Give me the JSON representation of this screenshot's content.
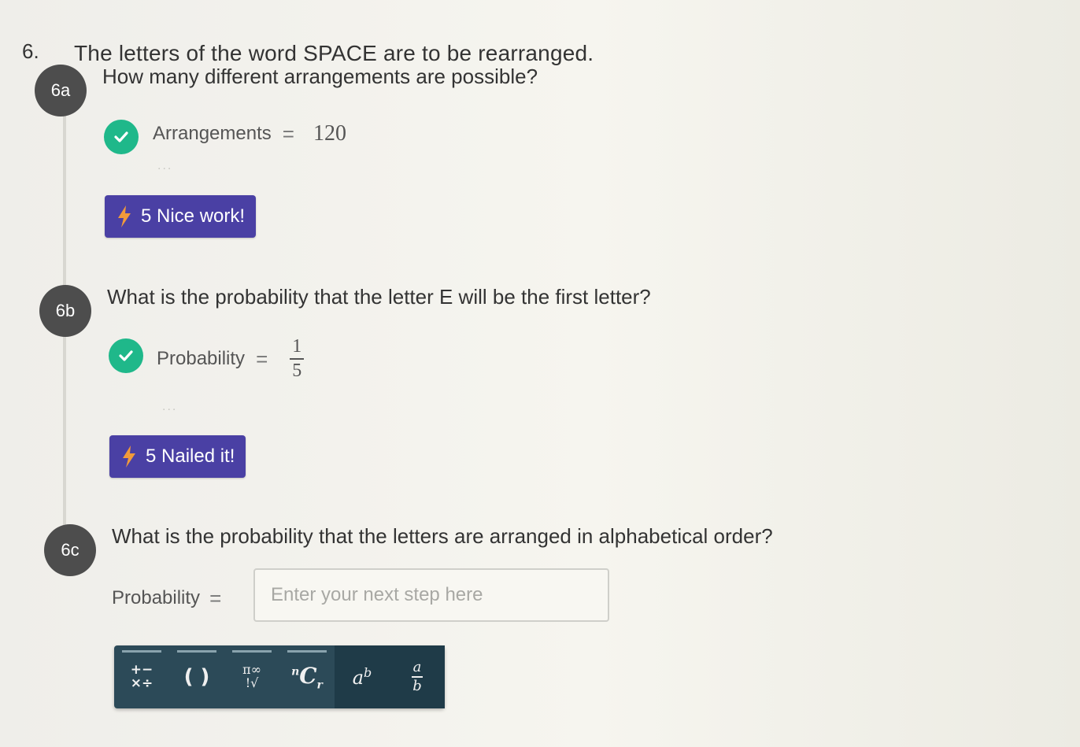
{
  "question": {
    "number": "6.",
    "title": "The letters of the word SPACE are to be rearranged."
  },
  "steps": [
    {
      "badge": "6a",
      "question": "How many different arrangements are possible?",
      "answer_label": "Arrangements",
      "equals": "=",
      "answer_value": "120",
      "dots": "...",
      "feedback": "5 Nice work!"
    },
    {
      "badge": "6b",
      "question": "What is the probability that the letter E will be the first letter?",
      "answer_label": "Probability",
      "equals": "=",
      "answer_numerator": "1",
      "answer_denominator": "5",
      "dots": "...",
      "feedback": "5 Nailed it!"
    },
    {
      "badge": "6c",
      "question": "What is the probability that the letters are arranged in alphabetical order?",
      "answer_label": "Probability",
      "equals": "=",
      "input_value": "",
      "input_placeholder": "Enter your next step here"
    }
  ],
  "toolbar": {
    "buttons": [
      {
        "name": "operators",
        "top": "+−",
        "bottom": "×÷"
      },
      {
        "name": "parentheses",
        "label": "( )"
      },
      {
        "name": "symbols",
        "top": "π∞",
        "bottom": "!√"
      },
      {
        "name": "combinations",
        "sup": "n",
        "main": "C",
        "sub": "r"
      },
      {
        "name": "exponent",
        "main": "a",
        "sup": "b"
      },
      {
        "name": "fraction",
        "numerator": "a",
        "denominator": "b"
      }
    ]
  },
  "colors": {
    "check_green": "#1fb88a",
    "pill_purple": "#4a40a4",
    "bolt_orange": "#f29a3a",
    "toolbar_bg": "#2c4a58",
    "badge_gray": "#4d4d4d"
  }
}
